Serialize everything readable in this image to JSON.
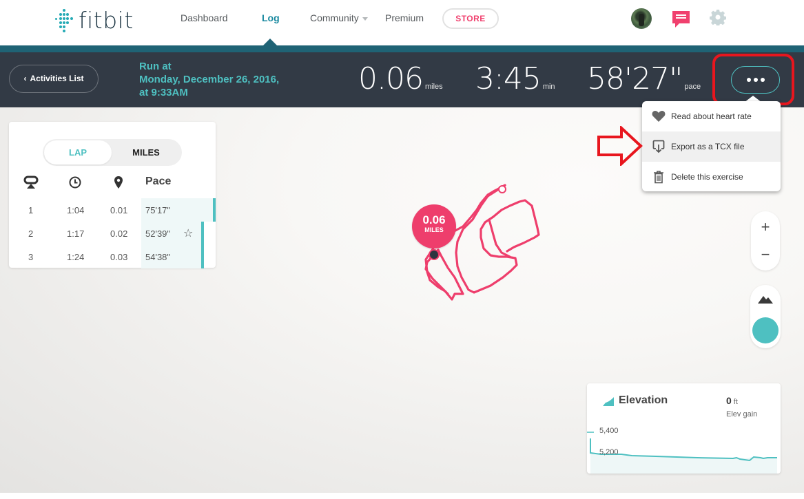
{
  "brand": {
    "name": "fitbit",
    "accent": "#4ec0c1",
    "pink": "#f0406e",
    "header_bg": "#323a45",
    "teal_bar": "#1f6375"
  },
  "nav": {
    "links": [
      {
        "label": "Dashboard",
        "active": false
      },
      {
        "label": "Log",
        "active": true
      },
      {
        "label": "Community",
        "active": false,
        "has_dropdown": true
      },
      {
        "label": "Premium",
        "active": false
      }
    ],
    "store_label": "STORE",
    "icons": [
      "avatar",
      "messages-icon",
      "settings-gear-icon"
    ]
  },
  "activity": {
    "back_label": "Activities List",
    "title_line1": "Run at",
    "title_line2": "Monday, December 26, 2016,",
    "title_line3": "at 9:33AM",
    "stats": [
      {
        "value": "0.06",
        "unit": "miles"
      },
      {
        "value": "3:45",
        "unit": "min"
      },
      {
        "value": "58'27\"",
        "unit": "pace"
      }
    ],
    "more_button": "more-options"
  },
  "menu": {
    "items": [
      {
        "label": "Read about heart rate",
        "icon": "heart-icon",
        "highlighted": false
      },
      {
        "label": "Export as a TCX file",
        "icon": "export-download-icon",
        "highlighted": true
      },
      {
        "label": "Delete this exercise",
        "icon": "trash-icon",
        "highlighted": false
      }
    ]
  },
  "laps": {
    "toggle": {
      "lap": "LAP",
      "miles": "MILES",
      "selected": "LAP"
    },
    "headers": {
      "lap_icon": "lap-icon",
      "time_icon": "clock-icon",
      "distance_icon": "location-pin-icon",
      "pace": "Pace"
    },
    "rows": [
      {
        "lap": "1",
        "time": "1:04",
        "distance": "0.01",
        "pace": "75'17\"",
        "best": false,
        "pace_fraction": 1.0
      },
      {
        "lap": "2",
        "time": "1:17",
        "distance": "0.02",
        "pace": "52'39\"",
        "best": true,
        "pace_fraction": 0.8
      },
      {
        "lap": "3",
        "time": "1:24",
        "distance": "0.03",
        "pace": "54'38\"",
        "best": false,
        "pace_fraction": 0.8
      }
    ]
  },
  "map": {
    "marker_value": "0.06",
    "marker_unit": "MILES",
    "zoom_in": "+",
    "zoom_out": "−"
  },
  "elevation": {
    "title": "Elevation",
    "gain_value": "0",
    "gain_unit": "ft",
    "gain_label": "Elev gain",
    "ticks": [
      "5,400",
      "5,200"
    ]
  }
}
